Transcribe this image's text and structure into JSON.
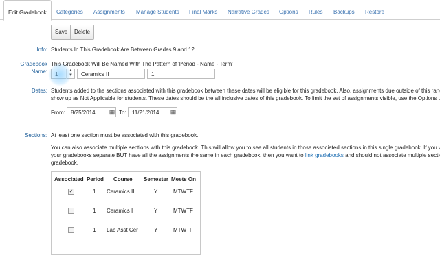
{
  "tabs": [
    {
      "label": "Edit Gradebook"
    },
    {
      "label": "Categories"
    },
    {
      "label": "Assignments"
    },
    {
      "label": "Manage Students"
    },
    {
      "label": "Final Marks"
    },
    {
      "label": "Narrative Grades"
    },
    {
      "label": "Options"
    },
    {
      "label": "Rules"
    },
    {
      "label": "Backups"
    },
    {
      "label": "Restore"
    }
  ],
  "toolbar": {
    "save_label": "Save",
    "delete_label": "Delete"
  },
  "info": {
    "label": "Info:",
    "text": "Students In This Gradebook Are Between Grades 9 and 12"
  },
  "gradebook_name": {
    "label_line1": "Gradebook",
    "label_line2": "Name:",
    "pattern_text": "This Gradebook Will Be Named With The Pattern of 'Period - Name - Term'",
    "period_value": "1",
    "name_value": "Ceramics II",
    "term_value": "1"
  },
  "dates": {
    "label": "Dates:",
    "description_line1": "Students added to the sections associated with this gradebook between these dates will be eligible for this gradebook. Also, assignments due outside of this rang",
    "description_line2": "show up as Not Applicable for students. These dates should be the all inclusive dates of this gradebook. To limit the set of assignments visible, use the Options ta",
    "from_label": "From:",
    "from_value": "8/25/2014",
    "to_label": "To:",
    "to_value": "11/21/2014"
  },
  "sections": {
    "label": "Sections:",
    "note": "At least one section must be associated with this gradebook.",
    "para_line1": "You can also associate multiple sections with this gradebook. This will allow you to see all students in those associated sections in this single gradebook. If you w",
    "para_line2a": "your gradebooks separate BUT have all the assignments the same in each gradebook, then you want to ",
    "para_link": "link gradebooks",
    "para_line2b": " and should not associate multiple sectio",
    "para_line3": "gradebook.",
    "columns": [
      "Associated",
      "Period",
      "Course",
      "Semester",
      "Meets On"
    ],
    "rows": [
      {
        "checked": true,
        "period": "1",
        "course": "Ceramics II",
        "semester": "Y",
        "meets": "MTWTF"
      },
      {
        "checked": false,
        "period": "1",
        "course": "Ceramics I",
        "semester": "Y",
        "meets": "MTWTF"
      },
      {
        "checked": false,
        "period": "1",
        "course": "Lab Asst Cer",
        "semester": "Y",
        "meets": "MTWTF"
      }
    ]
  }
}
